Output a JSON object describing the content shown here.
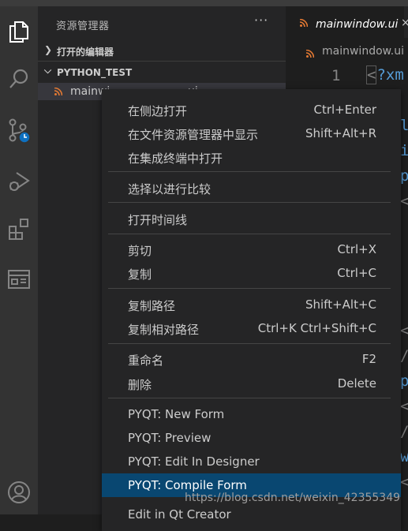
{
  "sidebar": {
    "title": "资源管理器",
    "more": "···",
    "open_editors": "打开的编辑器",
    "workspace": "PYTHON_TEST",
    "file_partial": "mainwi",
    "file_tail": "ui"
  },
  "editor": {
    "tab_label": "mainwindow.ui",
    "tab_close": "×",
    "breadcrumb": "mainwindow.ui",
    "line_number": "1",
    "code_line": {
      "lt": "<",
      "q": "?xm"
    },
    "peek": [
      "l",
      "i",
      "p",
      "<",
      "<",
      "/",
      "p",
      "<",
      "/",
      "w",
      "<"
    ]
  },
  "menu": {
    "items": [
      {
        "label": "在侧边打开",
        "shortcut": "Ctrl+Enter"
      },
      {
        "label": "在文件资源管理器中显示",
        "shortcut": "Shift+Alt+R"
      },
      {
        "label": "在集成终端中打开",
        "shortcut": ""
      },
      {
        "label": "选择以进行比较",
        "shortcut": ""
      },
      {
        "label": "打开时间线",
        "shortcut": ""
      },
      {
        "label": "剪切",
        "shortcut": "Ctrl+X"
      },
      {
        "label": "复制",
        "shortcut": "Ctrl+C"
      },
      {
        "label": "复制路径",
        "shortcut": "Shift+Alt+C"
      },
      {
        "label": "复制相对路径",
        "shortcut": "Ctrl+K Ctrl+Shift+C"
      },
      {
        "label": "重命名",
        "shortcut": "F2"
      },
      {
        "label": "删除",
        "shortcut": "Delete"
      },
      {
        "label": "PYQT: New Form",
        "shortcut": ""
      },
      {
        "label": "PYQT: Preview",
        "shortcut": ""
      },
      {
        "label": "PYQT: Edit In Designer",
        "shortcut": ""
      },
      {
        "label": "PYQT: Compile Form",
        "shortcut": ""
      },
      {
        "label": "Edit in Qt Creator",
        "shortcut": ""
      }
    ]
  },
  "watermark": "https://blog.csdn.net/weixin_42355349",
  "colors": {
    "accent": "#094771",
    "rss": "#e37933",
    "activity_bar": "#333333",
    "sidebar": "#252526"
  },
  "icons": [
    "explorer-icon",
    "search-icon",
    "source-control-icon",
    "run-debug-icon",
    "extensions-icon",
    "browser-preview-icon",
    "account-icon",
    "rss-file-icon",
    "clock-badge-icon"
  ]
}
